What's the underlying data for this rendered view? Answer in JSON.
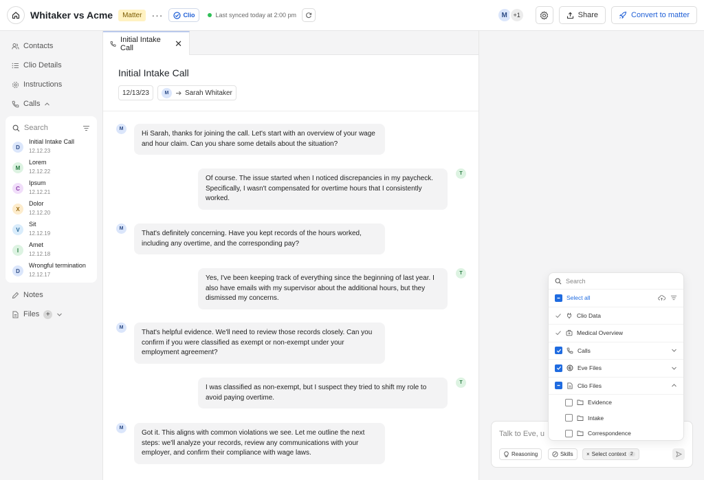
{
  "header": {
    "title": "Whitaker vs Acme",
    "badge": "Matter",
    "more": "···",
    "clio_label": "Clio",
    "sync_text": "Last synced today at 2:00 pm",
    "avatar_initial": "M",
    "avatar_extra": "+1",
    "share_label": "Share",
    "convert_label": "Convert to matter"
  },
  "sidebar": {
    "contacts": "Contacts",
    "clio_details": "Clio Details",
    "instructions": "Instructions",
    "calls": "Calls",
    "search_placeholder": "Search",
    "call_list": [
      {
        "initial": "D",
        "name": "Initial Intake Call",
        "date": "12.12.23",
        "color": "#dbe6fb",
        "fg": "#2e4c86"
      },
      {
        "initial": "M",
        "name": "Lorem",
        "date": "12.12.22",
        "color": "#ddf3e2",
        "fg": "#277a40"
      },
      {
        "initial": "C",
        "name": "Ipsum",
        "date": "12.12.21",
        "color": "#f1defa",
        "fg": "#8a3aa8"
      },
      {
        "initial": "X",
        "name": "Dolor",
        "date": "12.12.20",
        "color": "#fdeccc",
        "fg": "#9a6a10"
      },
      {
        "initial": "V",
        "name": "Sit",
        "date": "12.12.19",
        "color": "#d9ecfb",
        "fg": "#2a6a9a"
      },
      {
        "initial": "I",
        "name": "Amet",
        "date": "12.12.18",
        "color": "#ddf3e2",
        "fg": "#277a40"
      },
      {
        "initial": "D",
        "name": "Wrongful termination",
        "date": "12.12.17",
        "color": "#dbe6fb",
        "fg": "#2e4c86"
      }
    ],
    "notes": "Notes",
    "files": "Files"
  },
  "main": {
    "tab_label": "Initial Intake Call",
    "call_title": "Initial Intake Call",
    "date": "12/13/23",
    "from_initial": "M",
    "to_name": "Sarah Whitaker",
    "messages": [
      {
        "side": "left",
        "initial": "M",
        "text": "Hi Sarah, thanks for joining the call. Let's start with an overview of your wage and hour claim. Can you share some details about the situation?"
      },
      {
        "side": "right",
        "initial": "T",
        "text": "Of course. The issue started when I noticed discrepancies in my paycheck. Specifically, I wasn't compensated for overtime hours that I consistently worked."
      },
      {
        "side": "left",
        "initial": "M",
        "text": "That's definitely concerning. Have you kept records of the hours worked, including any overtime, and the corresponding pay?"
      },
      {
        "side": "right",
        "initial": "T",
        "text": "Yes, I've been keeping track of everything since the beginning of last year. I also have emails with my supervisor about the additional hours, but they dismissed my concerns."
      },
      {
        "side": "left",
        "initial": "M",
        "text": "That's helpful evidence. We'll need to review those records closely. Can you confirm if you were classified as exempt or non-exempt under your employment agreement?"
      },
      {
        "side": "right",
        "initial": "T",
        "text": "I was classified as non-exempt, but I suspect they tried to shift my role to avoid paying overtime."
      },
      {
        "side": "left",
        "initial": "M",
        "text": "Got it. This aligns with common violations we see. Let me outline the next steps: we'll analyze your records, review any communications with your employer, and confirm their compliance with wage laws."
      }
    ]
  },
  "dropdown": {
    "search_placeholder": "Search",
    "select_all": "Select all",
    "clio_data": "Clio Data",
    "medical_overview": "Medical Overview",
    "calls": "Calls",
    "eve_files": "Eve Files",
    "clio_files": "Clio Files",
    "evidence": "Evidence",
    "intake": "Intake",
    "correspondence": "Correspondence"
  },
  "chat": {
    "placeholder": "Talk to Eve, u",
    "reasoning": "Reasoning",
    "skills": "Skills",
    "select_context": "Select context",
    "context_count": "2"
  },
  "colors": {
    "accent": "#1f6be0",
    "sync_green": "#2fbf57"
  }
}
